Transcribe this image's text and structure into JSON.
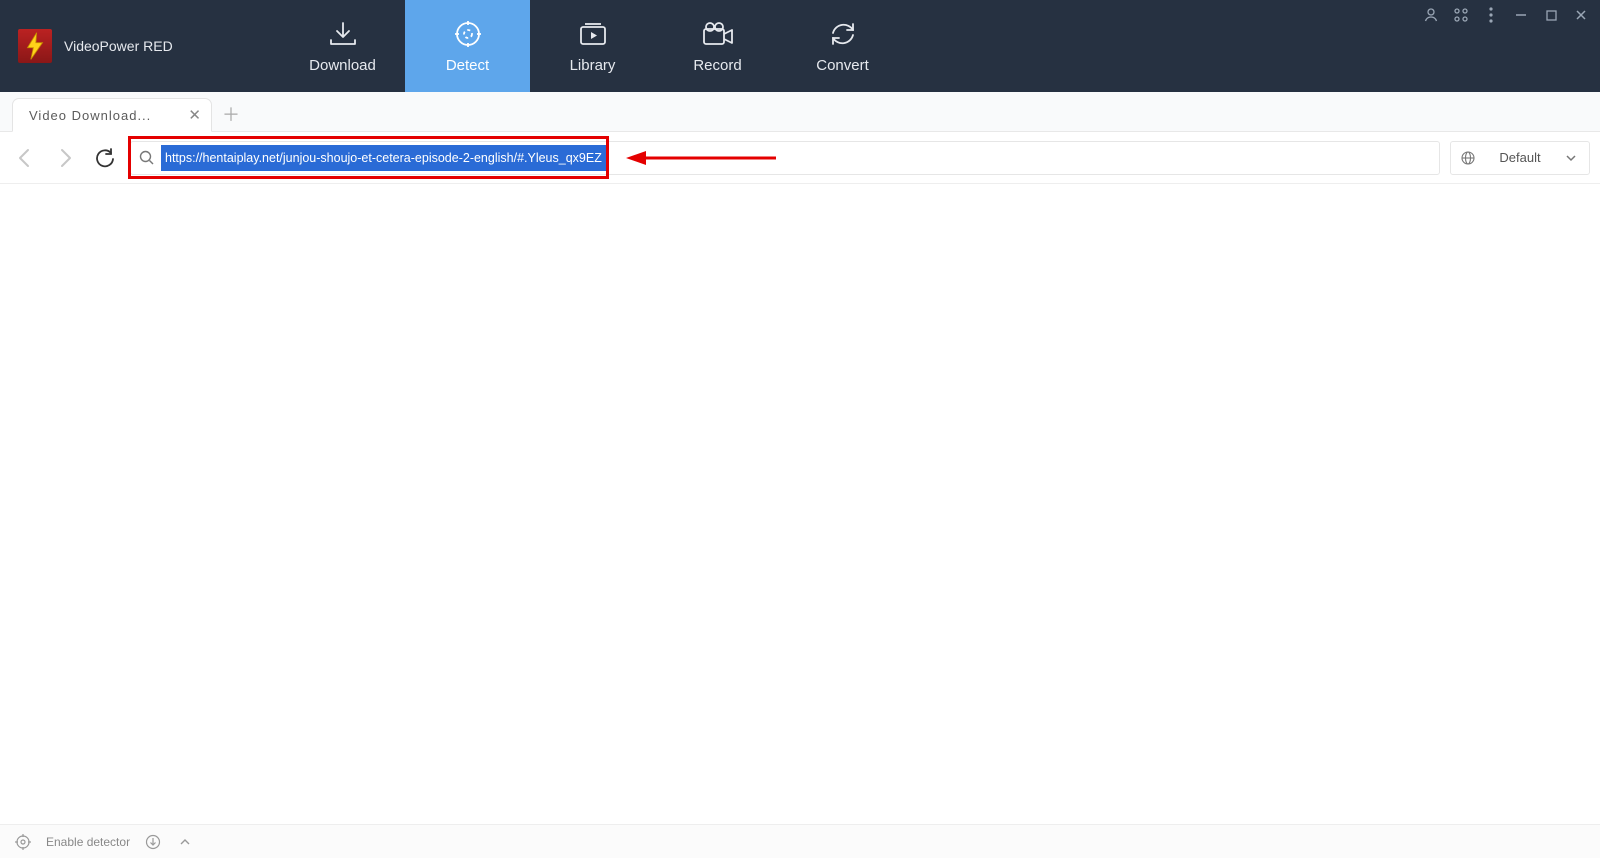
{
  "app": {
    "name": "VideoPower RED"
  },
  "nav": {
    "items": [
      {
        "label": "Download"
      },
      {
        "label": "Detect",
        "active": true
      },
      {
        "label": "Library"
      },
      {
        "label": "Record"
      },
      {
        "label": "Convert"
      }
    ]
  },
  "tabs": {
    "items": [
      {
        "title": "Video  Download..."
      }
    ]
  },
  "address": {
    "url": "https://hentaiplay.net/junjou-shoujo-et-cetera-episode-2-english/#.Yleus_qx9EZ"
  },
  "quality": {
    "selected": "Default"
  },
  "status": {
    "detector_label": "Enable detector"
  }
}
